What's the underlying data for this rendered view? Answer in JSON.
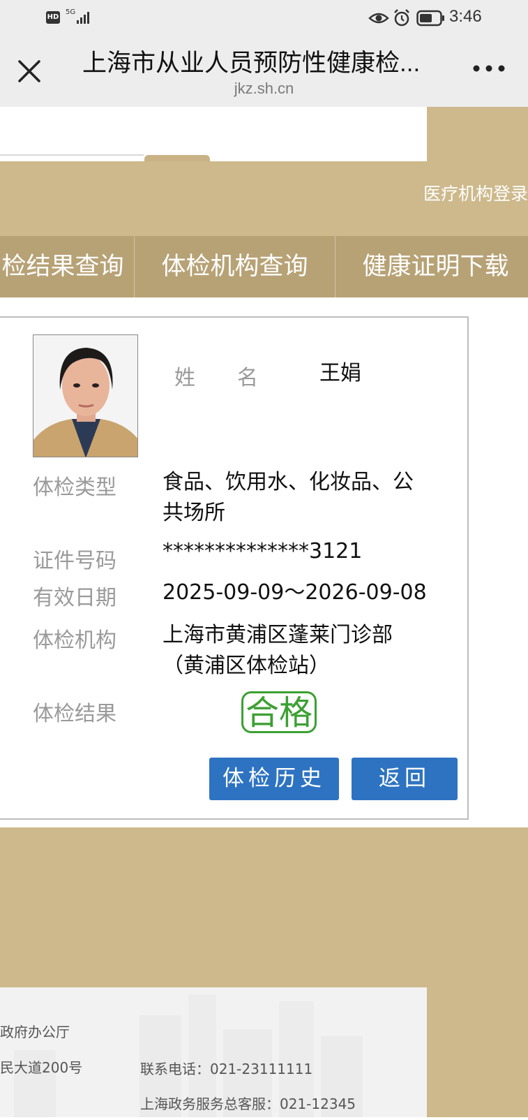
{
  "status_bar": {
    "hd_badge": "HD",
    "network": "5G",
    "time": "3:46",
    "icons": [
      "eye-icon",
      "alarm-icon",
      "battery-icon"
    ]
  },
  "browser": {
    "title": "上海市从业人员预防性健康检...",
    "url": "jkz.sh.cn"
  },
  "header": {
    "medical_login": "医疗机构登录"
  },
  "nav": {
    "items": [
      "检结果查询",
      "体检机构查询",
      "健康证明下载"
    ]
  },
  "record": {
    "name_label": "姓　　名",
    "name_value": "王娟",
    "type_label": "体检类型",
    "type_value": "食品、饮用水、化妆品、公共场所",
    "id_label": "证件号码",
    "id_value": "**************3121",
    "validity_label": "有效日期",
    "validity_value": "2025-09-09～2026-09-08",
    "institution_label": "体检机构",
    "institution_value": "上海市黄浦区蓬莱门诊部（黄浦区体检站）",
    "result_label": "体检结果",
    "result_value": "合格"
  },
  "buttons": {
    "history": "体检历史",
    "back": "返回"
  },
  "footer": {
    "line1": "政府办公厅",
    "line2": "民大道200号",
    "phone": "联系电话：021-23111111",
    "service": "上海政务服务总客服：021-12345"
  },
  "colors": {
    "tan": "#cdb98c",
    "nav_tan": "#b7a276",
    "button_blue": "#2e73c2",
    "stamp_green": "#3ca033"
  }
}
